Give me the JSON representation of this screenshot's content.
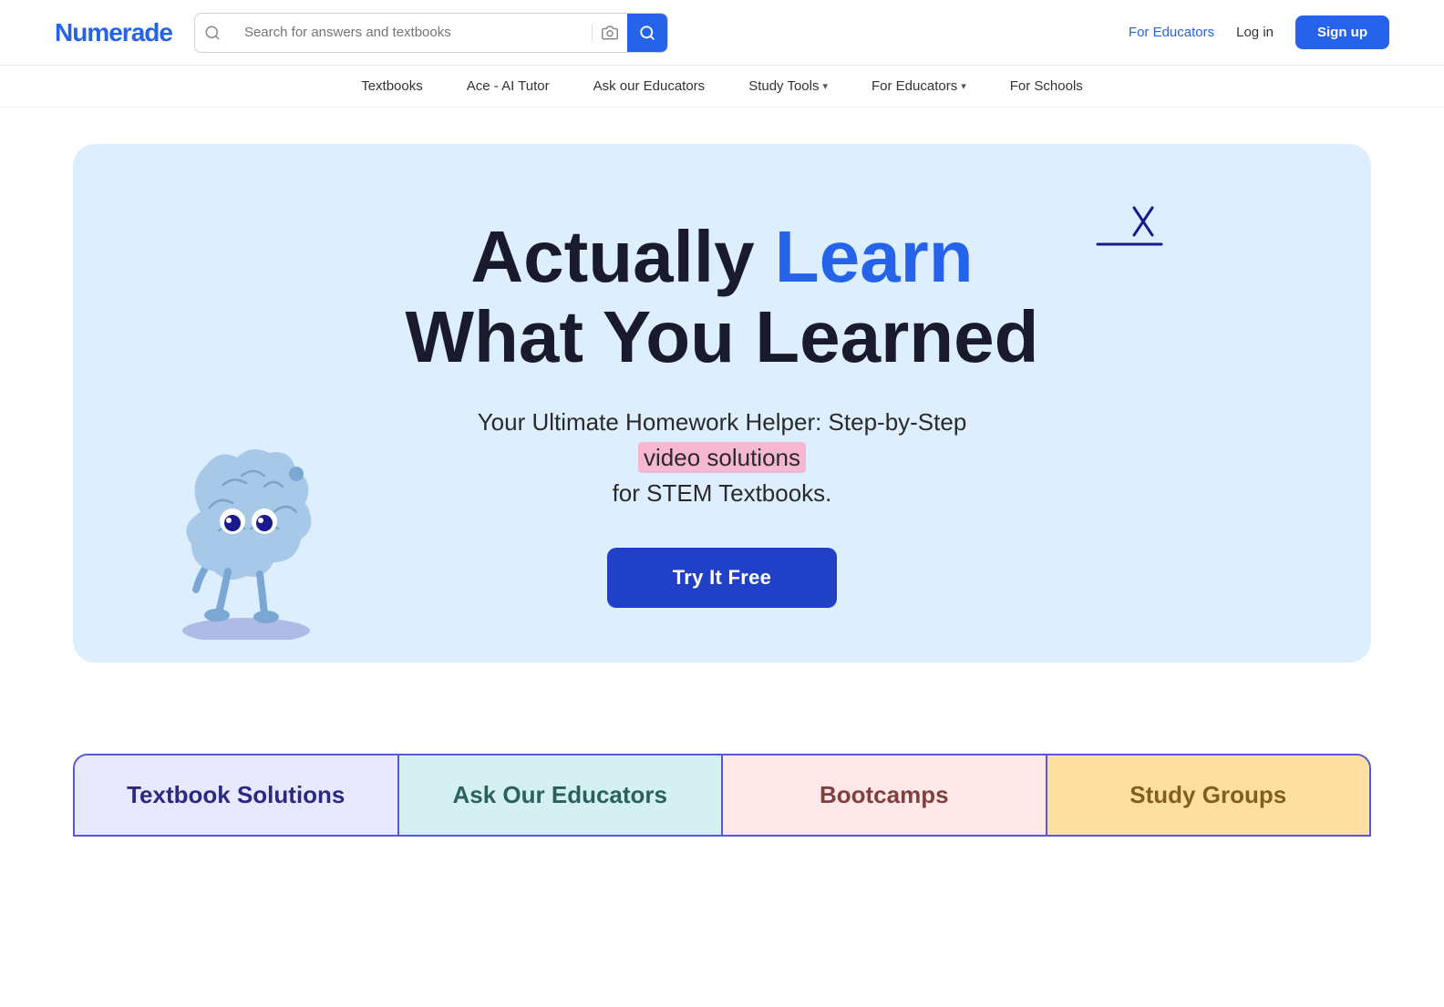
{
  "logo": {
    "text_black": "Numerad",
    "text_blue": "e"
  },
  "header": {
    "search_placeholder": "Search for answers and textbooks",
    "for_educators_label": "For Educators",
    "login_label": "Log in",
    "signup_label": "Sign up"
  },
  "nav": {
    "items": [
      {
        "label": "Textbooks",
        "has_dropdown": false
      },
      {
        "label": "Ace - AI Tutor",
        "has_dropdown": false
      },
      {
        "label": "Ask our Educators",
        "has_dropdown": false
      },
      {
        "label": "Study Tools",
        "has_dropdown": true
      },
      {
        "label": "For Educators",
        "has_dropdown": true
      },
      {
        "label": "For Schools",
        "has_dropdown": false
      }
    ]
  },
  "hero": {
    "title_line1_start": "Actually ",
    "title_line1_highlight": "Learn",
    "title_line2": "What You Learned",
    "subtitle_line1": "Your Ultimate Homework Helper: Step-by-Step",
    "subtitle_highlight": "video solutions",
    "subtitle_line3": "for STEM Textbooks.",
    "cta_button": "Try It Free"
  },
  "tabs": [
    {
      "label": "Textbook Solutions",
      "style": "textbook"
    },
    {
      "label": "Ask Our Educators",
      "style": "educators"
    },
    {
      "label": "Bootcamps",
      "style": "bootcamps"
    },
    {
      "label": "Study Groups",
      "style": "study-groups"
    }
  ]
}
